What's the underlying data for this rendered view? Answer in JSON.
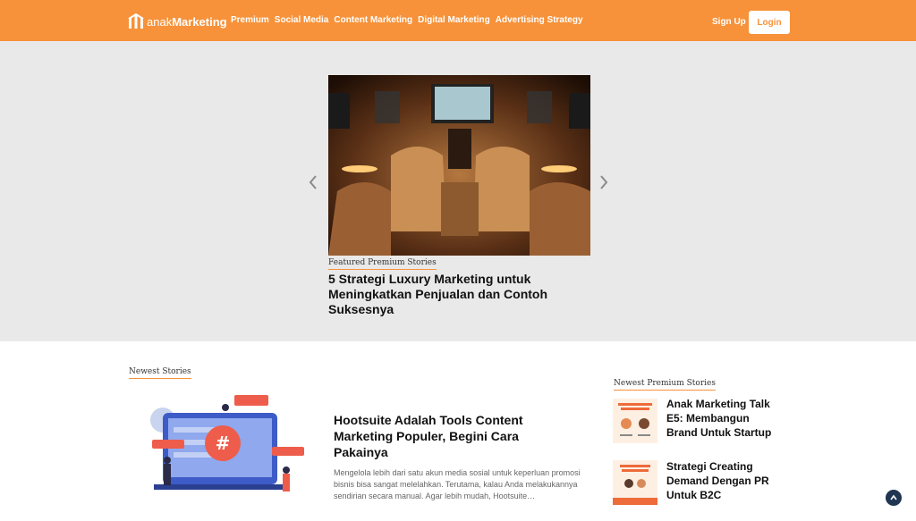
{
  "header": {
    "logo_text_light": "anak",
    "logo_text_bold": "Marketing",
    "nav": [
      "Premium",
      "Social Media",
      "Content Marketing",
      "Digital Marketing",
      "Advertising Strategy"
    ],
    "signup_label": "Sign Up",
    "login_label": "Login",
    "brand_color": "#f7923a"
  },
  "hero": {
    "prev_icon": "chevron-left-icon",
    "next_icon": "chevron-right-icon",
    "kicker": "Featured Premium Stories",
    "title": "5 Strategi Luxury Marketing untuk Meningkatkan Penjualan dan Contoh Suksesnya"
  },
  "newest": {
    "kicker": "Newest Stories",
    "story": {
      "title": "Hootsuite Adalah Tools Content Marketing Populer, Begini Cara Pakainya",
      "excerpt": "Mengelola lebih dari satu akun media sosial untuk keperluan promosi bisnis bisa sangat melelahkan. Terutama, kalau Anda melakukannya sendirian secara manual. Agar lebih mudah, Hootsuite…"
    }
  },
  "premium": {
    "kicker": "Newest Premium Stories",
    "items": [
      {
        "title": "Anak Marketing Talk E5: Membangun Brand Untuk Startup"
      },
      {
        "title": "Strategi Creating Demand Dengan PR Untuk B2C"
      }
    ]
  },
  "back_to_top_icon": "arrow-up-icon"
}
